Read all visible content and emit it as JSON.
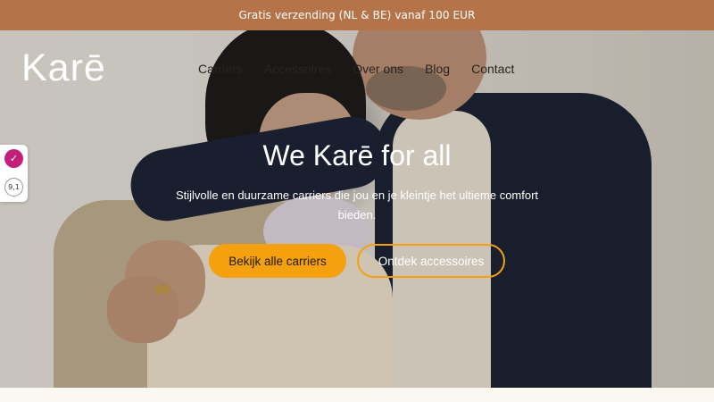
{
  "announcement": {
    "text": "Gratis verzending (NL & BE) vanaf 100 EUR"
  },
  "brand": {
    "logo_text": "Karē"
  },
  "nav": {
    "items": [
      {
        "label": "Carriers"
      },
      {
        "label": "Accessoires"
      },
      {
        "label": "Over ons"
      },
      {
        "label": "Blog"
      },
      {
        "label": "Contact"
      }
    ]
  },
  "review_widget": {
    "badge": "✓",
    "score": "9,1"
  },
  "hero": {
    "title": "We Karē for all",
    "subtitle": "Stijlvolle en duurzame carriers die jou en je kleintje het ultieme comfort bieden.",
    "primary_button": "Bekijk alle carriers",
    "secondary_button": "Ontdek accessoires"
  },
  "colors": {
    "announcement_bg": "#b57349",
    "accent": "#f5a00f",
    "page_bg": "#fbf8f2"
  }
}
